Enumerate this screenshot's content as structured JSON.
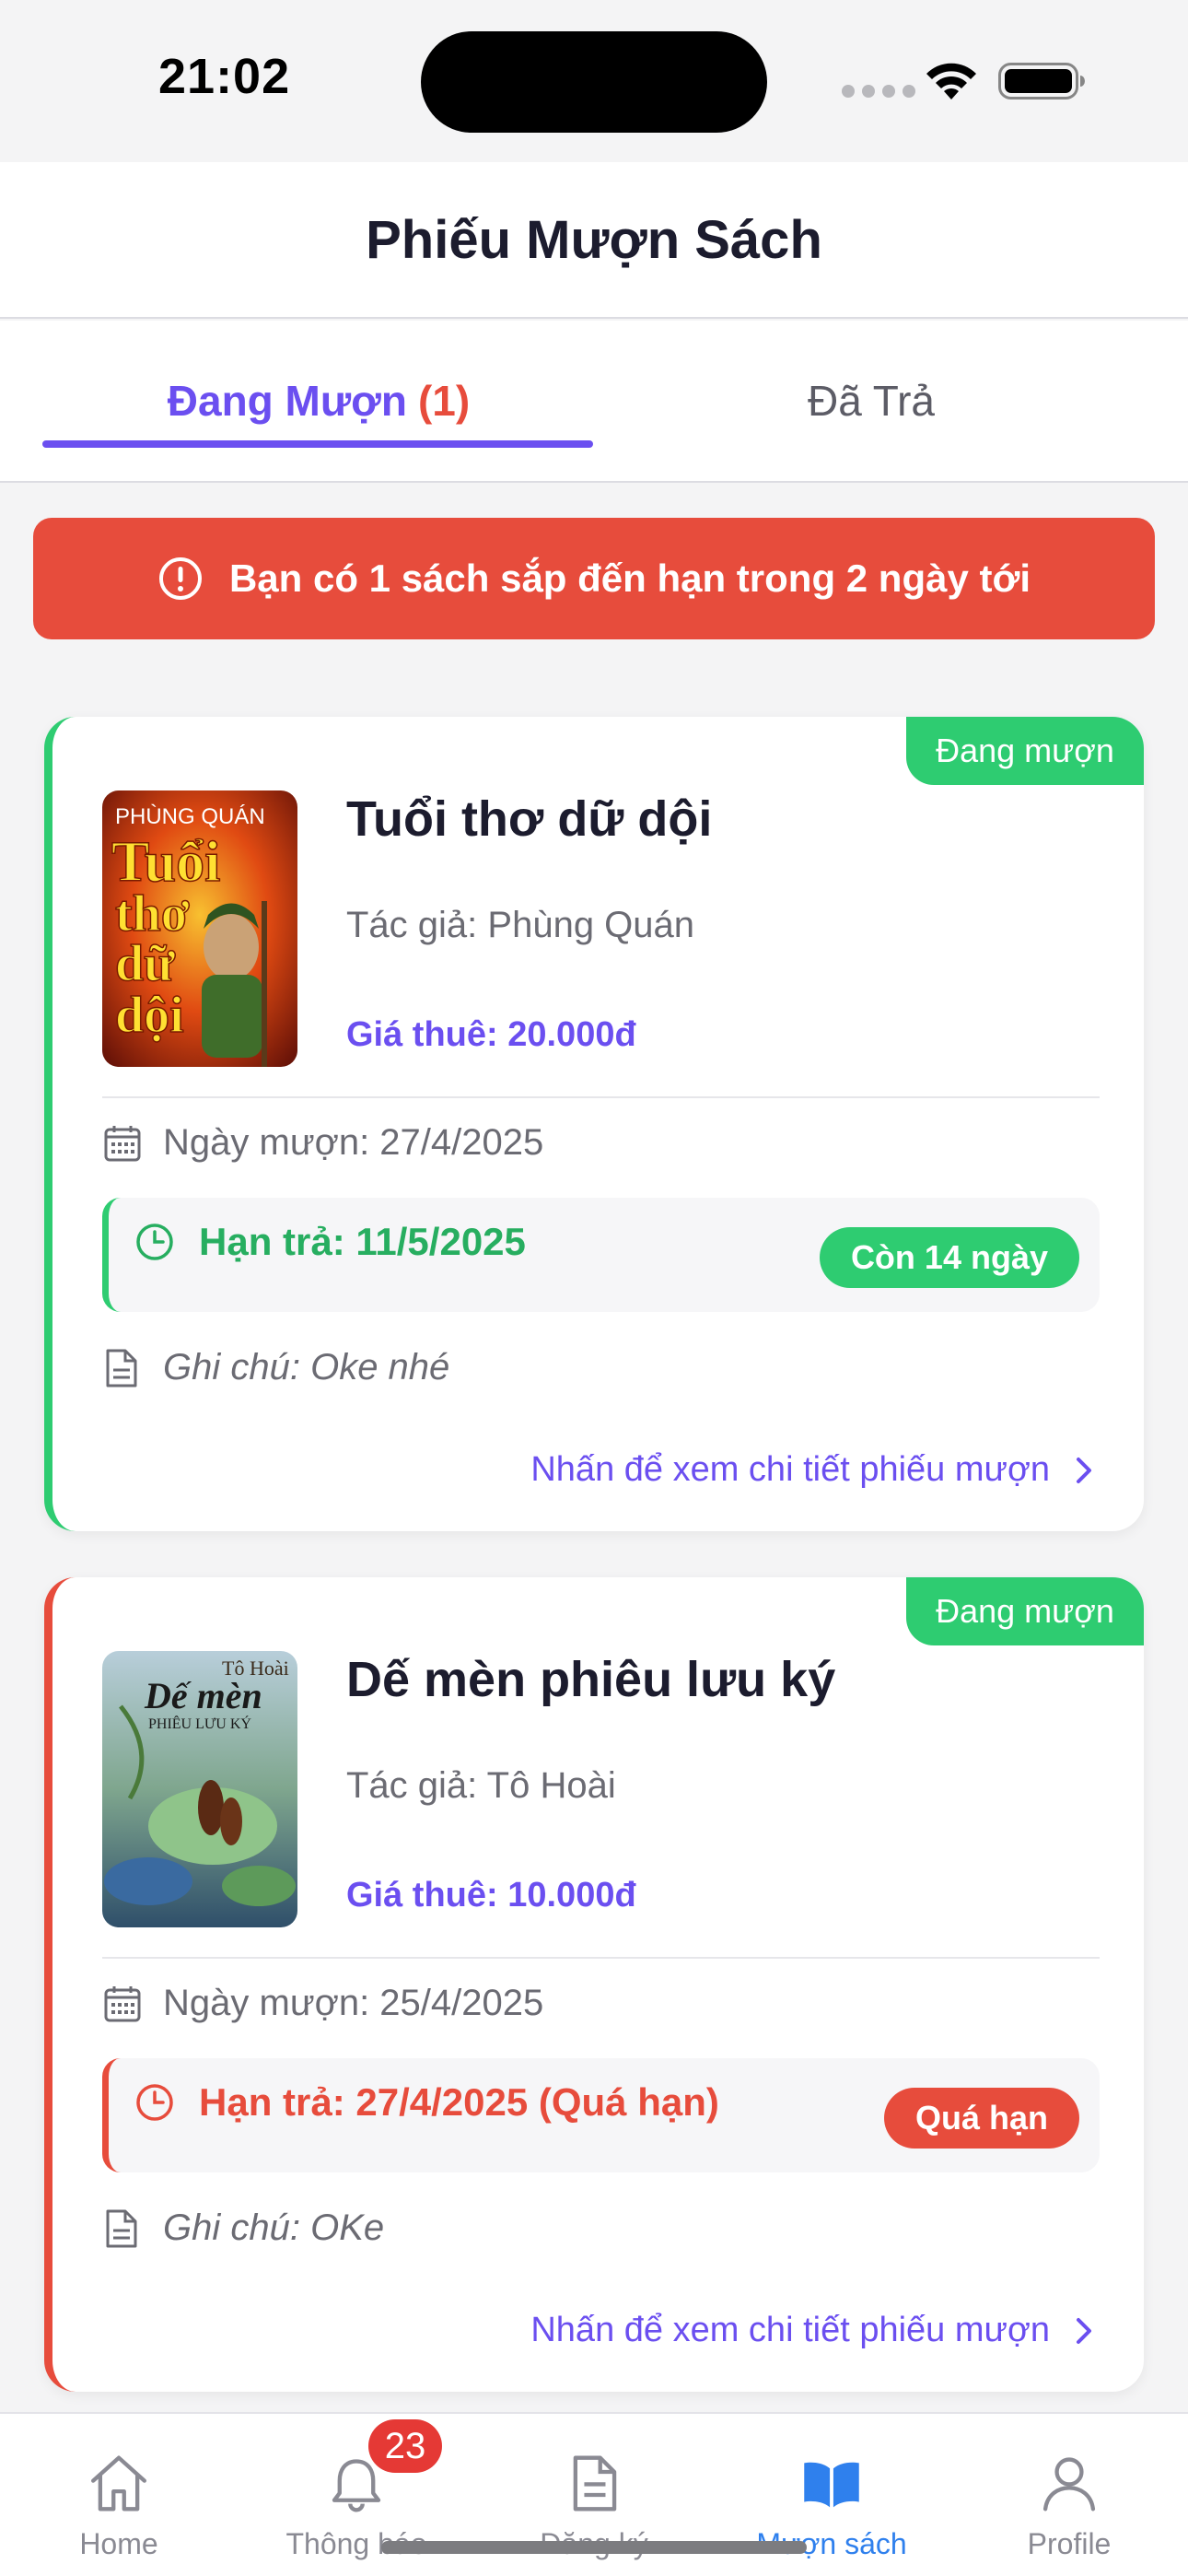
{
  "status_bar": {
    "time": "21:02"
  },
  "header": {
    "title": "Phiếu Mượn Sách"
  },
  "tabs": {
    "active_label": "Đang Mượn",
    "active_count": "(1)",
    "inactive_label": "Đã Trả"
  },
  "alert": {
    "text": "Bạn có 1 sách sắp đến hạn trong 2 ngày tới"
  },
  "cards": [
    {
      "status_badge": "Đang mượn",
      "cover_title_lines": [
        "PHÙNG QUÁN",
        "Tuổi",
        "thơ",
        "dữ",
        "dội"
      ],
      "title": "Tuổi thơ dữ dội",
      "author": "Tác giả: Phùng Quán",
      "price": "Giá thuê: 20.000đ",
      "borrow_date": "Ngày mượn: 27/4/2025",
      "due_date": "Hạn trả: 11/5/2025",
      "due_pill": "Còn 14 ngày",
      "note": "Ghi chú: Oke nhé",
      "detail_link": "Nhấn để xem chi tiết phiếu mượn",
      "accent": "#2ecc71"
    },
    {
      "status_badge": "Đang mượn",
      "cover_title_lines": [
        "Tô Hoài",
        "Dế mèn",
        "PHIÊU LƯU KÝ"
      ],
      "title": "Dế mèn phiêu lưu ký",
      "author": "Tác giả: Tô Hoài",
      "price": "Giá thuê: 10.000đ",
      "borrow_date": "Ngày mượn: 25/4/2025",
      "due_date": "Hạn trả: 27/4/2025 (Quá hạn)",
      "due_pill": "Quá hạn",
      "note": "Ghi chú: OKe",
      "detail_link": "Nhấn để xem chi tiết phiếu mượn",
      "accent": "#e74c3c"
    }
  ],
  "tabbar": {
    "items": [
      {
        "label": "Home",
        "icon": "home-icon"
      },
      {
        "label": "Thông báo",
        "icon": "bell-icon",
        "badge": "23"
      },
      {
        "label": "Đăng ký",
        "icon": "document-icon"
      },
      {
        "label": "Mượn sách",
        "icon": "open-book-icon",
        "active": true
      },
      {
        "label": "Profile",
        "icon": "user-icon"
      }
    ]
  },
  "colors": {
    "primary": "#6b4ff0",
    "success": "#2ecc71",
    "danger": "#e74c3c",
    "tab_active": "#2f80ed"
  }
}
